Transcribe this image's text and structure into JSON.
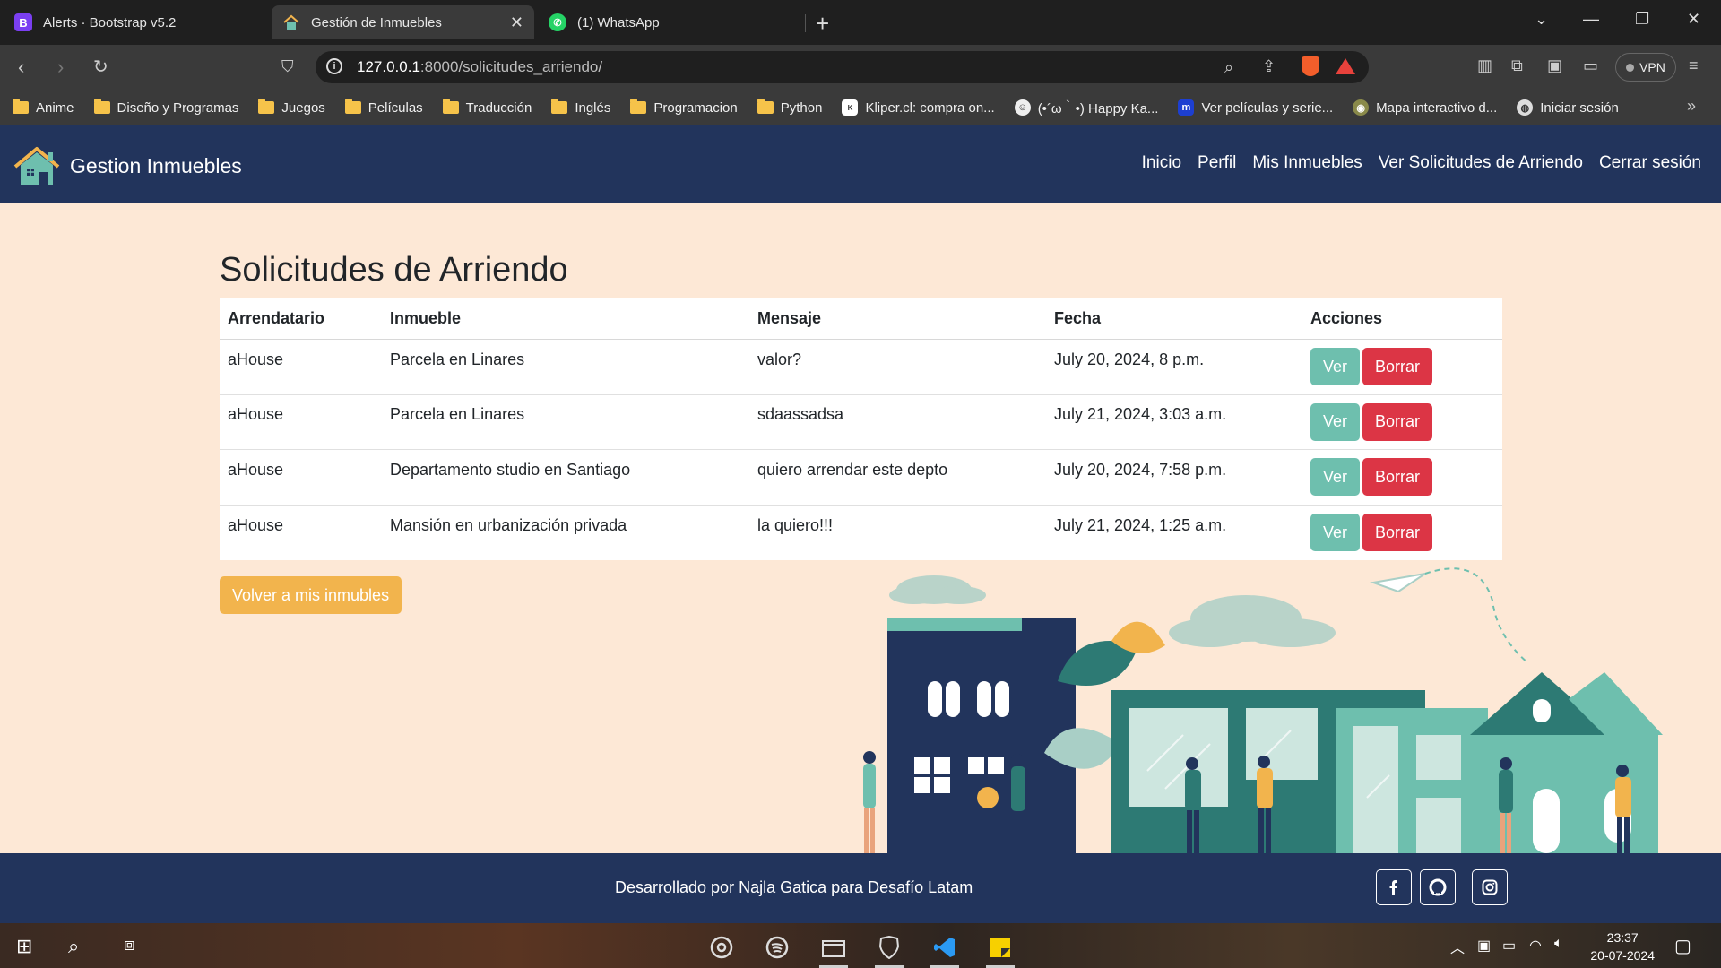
{
  "browser": {
    "tabs": [
      {
        "title": "Alerts · Bootstrap v5.2",
        "favicon": "bootstrap-icon"
      },
      {
        "title": "Gestión de Inmuebles",
        "favicon": "house-icon"
      },
      {
        "title": "(1) WhatsApp",
        "favicon": "whatsapp-icon"
      }
    ],
    "url_host": "127.0.0.1",
    "url_rest": ":8000/solicitudes_arriendo/",
    "vpn_label": "VPN",
    "bookmarks": [
      {
        "label": "Anime",
        "icon": "folder-icon"
      },
      {
        "label": "Diseño y Programas",
        "icon": "folder-icon"
      },
      {
        "label": "Juegos",
        "icon": "folder-icon"
      },
      {
        "label": "Películas",
        "icon": "folder-icon"
      },
      {
        "label": "Traducción",
        "icon": "folder-icon"
      },
      {
        "label": "Inglés",
        "icon": "folder-icon"
      },
      {
        "label": "Programacion",
        "icon": "folder-icon"
      },
      {
        "label": "Python",
        "icon": "folder-icon"
      },
      {
        "label": "Kliper.cl: compra on...",
        "icon": "kliper-icon"
      },
      {
        "label": "(•´ω｀•) Happy Ka...",
        "icon": "emoji-icon"
      },
      {
        "label": "Ver películas y serie...",
        "icon": "m-icon"
      },
      {
        "label": "Mapa interactivo d...",
        "icon": "map-icon"
      },
      {
        "label": "Iniciar sesión",
        "icon": "globe-icon"
      }
    ]
  },
  "site": {
    "brand": "Gestion Inmuebles",
    "nav": [
      "Inicio",
      "Perfil",
      "Mis Inmuebles",
      "Ver Solicitudes de Arriendo",
      "Cerrar sesión"
    ]
  },
  "main": {
    "title": "Solicitudes de Arriendo",
    "columns": [
      "Arrendatario",
      "Inmueble",
      "Mensaje",
      "Fecha",
      "Acciones"
    ],
    "rows": [
      {
        "arrendatario": "aHouse",
        "inmueble": "Parcela en Linares",
        "mensaje": "valor?",
        "fecha": "July 20, 2024, 8 p.m."
      },
      {
        "arrendatario": "aHouse",
        "inmueble": "Parcela en Linares",
        "mensaje": "sdaassadsa",
        "fecha": "July 21, 2024, 3:03 a.m."
      },
      {
        "arrendatario": "aHouse",
        "inmueble": "Departamento studio en Santiago",
        "mensaje": "quiero arrendar este depto",
        "fecha": "July 20, 2024, 7:58 p.m."
      },
      {
        "arrendatario": "aHouse",
        "inmueble": "Mansión en urbanización privada",
        "mensaje": "la quiero!!!",
        "fecha": "July 21, 2024, 1:25 a.m."
      }
    ],
    "ver_label": "Ver",
    "borrar_label": "Borrar",
    "back_label": "Volver a mis inmubles"
  },
  "footer": {
    "text": "Desarrollado por Najla Gatica para Desafío Latam",
    "social": [
      "facebook-icon",
      "github-icon",
      "instagram-icon"
    ]
  },
  "taskbar": {
    "time": "23:37",
    "date": "20-07-2024"
  },
  "colors": {
    "navbar": "#22345c",
    "page_bg": "#fde8d6",
    "ver": "#6ebfae",
    "borrar": "#dc3545",
    "back": "#f2b44d"
  }
}
